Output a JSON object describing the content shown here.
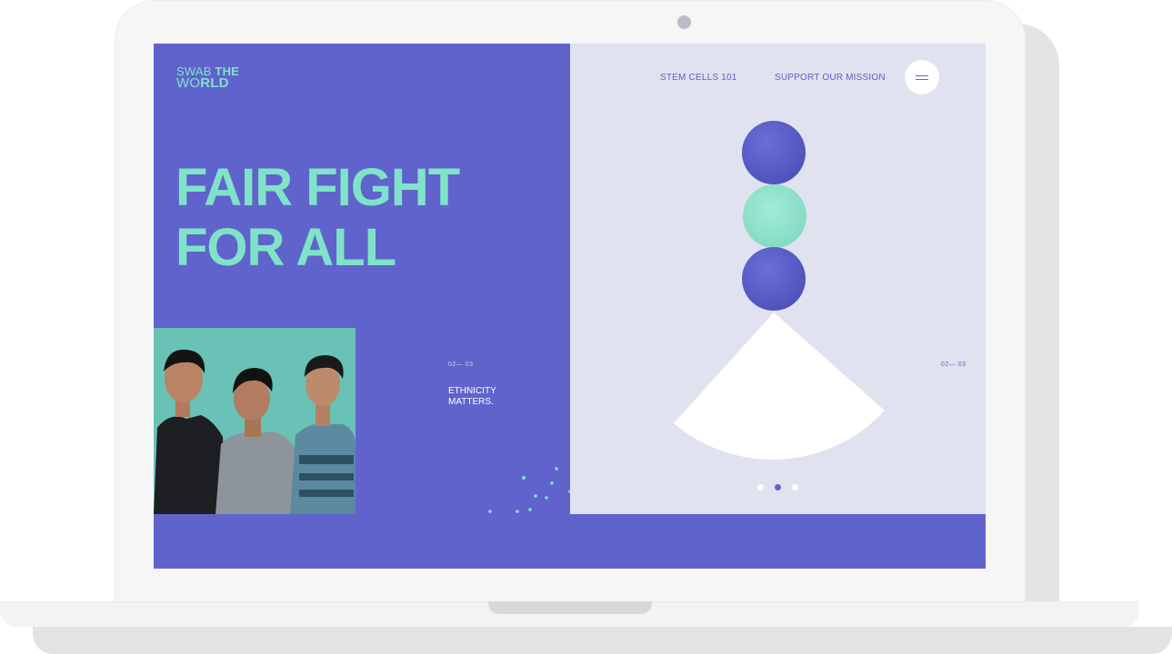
{
  "site": {
    "logo_line1_a": "SWAB ",
    "logo_line1_b": "THE",
    "logo_line2_a": "WO",
    "logo_line2_b": "RLD"
  },
  "nav": {
    "stem_cells": "STEM CELLS 101",
    "support": "SUPPORT OUR MISSION"
  },
  "hero": {
    "headline_line1": "FAIR FIGHT",
    "headline_line2": "FOR ALL"
  },
  "slide": {
    "counter_left": "02— 03",
    "caption_line1": "ETHNICITY",
    "caption_line2": "MATTERS.",
    "counter_right": "02— 03"
  },
  "pagination": {
    "total": 3,
    "active_index": 1
  },
  "colors": {
    "brand_purple": "#6063cc",
    "mint": "#7fe3c8",
    "panel_light": "#e1e2ef",
    "photo_teal": "#69c2b5"
  },
  "icons": {
    "menu": "hamburger-icon",
    "camera": "webcam-icon"
  }
}
